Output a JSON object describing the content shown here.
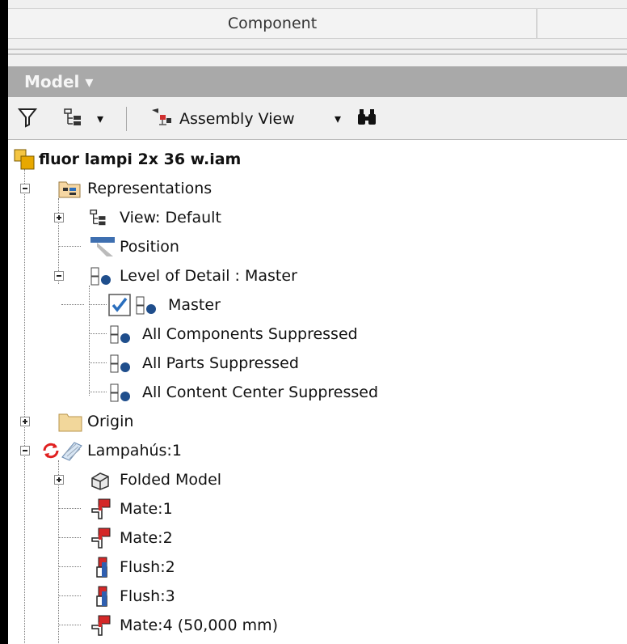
{
  "header": {
    "column_label": "Component"
  },
  "panel": {
    "title": "Model ▾"
  },
  "toolbar": {
    "filter_icon": "filter-icon",
    "hierarchy_icon": "hierarchy-icon",
    "dropdown_arrow": "▾",
    "view_label": "Assembly View",
    "search_icon": "binoculars-icon"
  },
  "tree": {
    "root": "fluor lampi 2x 36 w.iam",
    "representations": "Representations",
    "view_default": "View: Default",
    "position": "Position",
    "lod": "Level of Detail : Master",
    "lod_master": "Master",
    "lod_all_components": "All Components Suppressed",
    "lod_all_parts": "All Parts Suppressed",
    "lod_all_content_center": "All Content Center Suppressed",
    "origin": "Origin",
    "lampahus": "Lampahús:1",
    "folded_model": "Folded Model",
    "mate1": "Mate:1",
    "mate2": "Mate:2",
    "flush2": "Flush:2",
    "flush3": "Flush:3",
    "mate4": "Mate:4 (50,000 mm)"
  }
}
